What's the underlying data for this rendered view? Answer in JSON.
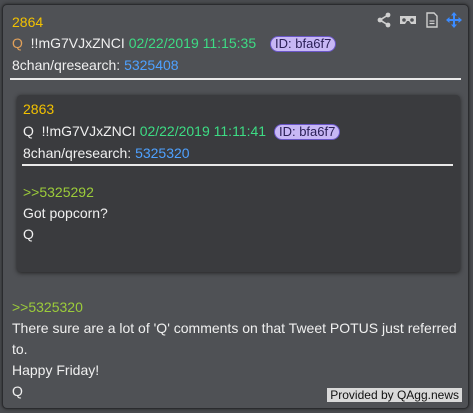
{
  "outer": {
    "number": "2864",
    "q": "Q",
    "trip": "!!mG7VJxZNCI",
    "date": "02/22/2019 11:15:35",
    "id": "ID: bfa6f7",
    "source_prefix": "8chan/qresearch: ",
    "source_link": "5325408",
    "reply_ref": ">>5325320",
    "lines": [
      "There sure are a lot of 'Q' comments on that Tweet POTUS just referred",
      "to.",
      "Happy Friday!",
      "Q"
    ]
  },
  "inner": {
    "number": "2863",
    "q": "Q",
    "trip": "!!mG7VJxZNCI",
    "date": "02/22/2019 11:11:41",
    "id": "ID: bfa6f7",
    "source_prefix": "8chan/qresearch: ",
    "source_link": "5325320",
    "reply_ref": ">>5325292",
    "lines": [
      "Got popcorn?",
      "Q"
    ]
  },
  "toolbar": {
    "icons": [
      "share-icon",
      "vr-headset-icon",
      "document-icon",
      "move-icon"
    ]
  },
  "footer": "Provided by QAgg.news"
}
